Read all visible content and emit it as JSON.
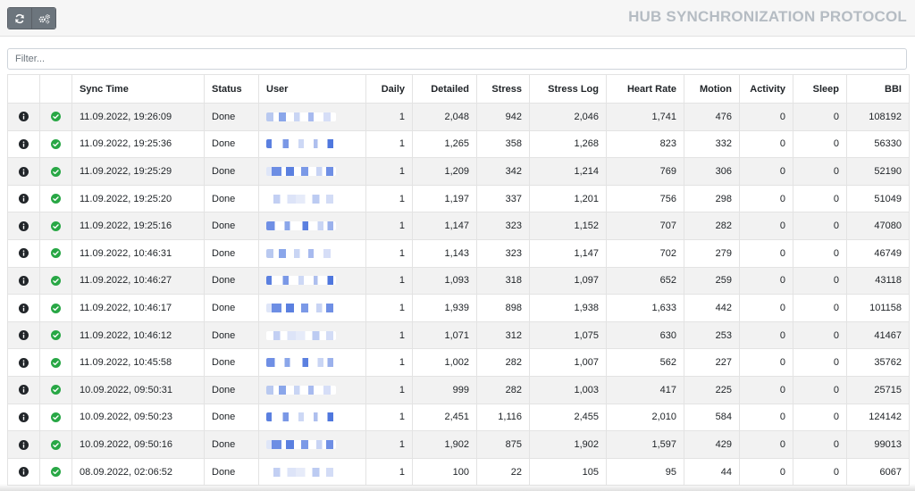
{
  "header": {
    "title": "HUB SYNCHRONIZATION PROTOCOL",
    "buttons": [
      {
        "icon": "refresh-icon"
      },
      {
        "icon": "gears-icon"
      }
    ]
  },
  "filter": {
    "placeholder": "Filter...",
    "value": ""
  },
  "colors": {
    "success": "#28a745",
    "info": "#212529",
    "button": "#6c757d",
    "title": "#b5bcc3",
    "stripe": "#f2f2f2"
  },
  "table": {
    "columns": [
      "",
      "",
      "Sync Time",
      "Status",
      "User",
      "Daily",
      "Detailed",
      "Stress",
      "Stress Log",
      "Heart Rate",
      "Motion",
      "Activity",
      "Sleep",
      "BBI"
    ],
    "rows": [
      {
        "sync_time": "11.09.2022, 19:26:09",
        "status": "Done",
        "daily": "1",
        "detailed": "2,048",
        "stress": "942",
        "stress_log": "2,046",
        "heart_rate": "1,741",
        "motion": "476",
        "activity": "0",
        "sleep": "0",
        "bbi": "108192"
      },
      {
        "sync_time": "11.09.2022, 19:25:36",
        "status": "Done",
        "daily": "1",
        "detailed": "1,265",
        "stress": "358",
        "stress_log": "1,268",
        "heart_rate": "823",
        "motion": "332",
        "activity": "0",
        "sleep": "0",
        "bbi": "56330"
      },
      {
        "sync_time": "11.09.2022, 19:25:29",
        "status": "Done",
        "daily": "1",
        "detailed": "1,209",
        "stress": "342",
        "stress_log": "1,214",
        "heart_rate": "769",
        "motion": "306",
        "activity": "0",
        "sleep": "0",
        "bbi": "52190"
      },
      {
        "sync_time": "11.09.2022, 19:25:20",
        "status": "Done",
        "daily": "1",
        "detailed": "1,197",
        "stress": "337",
        "stress_log": "1,201",
        "heart_rate": "756",
        "motion": "298",
        "activity": "0",
        "sleep": "0",
        "bbi": "51049"
      },
      {
        "sync_time": "11.09.2022, 19:25:16",
        "status": "Done",
        "daily": "1",
        "detailed": "1,147",
        "stress": "323",
        "stress_log": "1,152",
        "heart_rate": "707",
        "motion": "282",
        "activity": "0",
        "sleep": "0",
        "bbi": "47080"
      },
      {
        "sync_time": "11.09.2022, 10:46:31",
        "status": "Done",
        "daily": "1",
        "detailed": "1,143",
        "stress": "323",
        "stress_log": "1,147",
        "heart_rate": "702",
        "motion": "279",
        "activity": "0",
        "sleep": "0",
        "bbi": "46749"
      },
      {
        "sync_time": "11.09.2022, 10:46:27",
        "status": "Done",
        "daily": "1",
        "detailed": "1,093",
        "stress": "318",
        "stress_log": "1,097",
        "heart_rate": "652",
        "motion": "259",
        "activity": "0",
        "sleep": "0",
        "bbi": "43118"
      },
      {
        "sync_time": "11.09.2022, 10:46:17",
        "status": "Done",
        "daily": "1",
        "detailed": "1,939",
        "stress": "898",
        "stress_log": "1,938",
        "heart_rate": "1,633",
        "motion": "442",
        "activity": "0",
        "sleep": "0",
        "bbi": "101158"
      },
      {
        "sync_time": "11.09.2022, 10:46:12",
        "status": "Done",
        "daily": "1",
        "detailed": "1,071",
        "stress": "312",
        "stress_log": "1,075",
        "heart_rate": "630",
        "motion": "253",
        "activity": "0",
        "sleep": "0",
        "bbi": "41467"
      },
      {
        "sync_time": "11.09.2022, 10:45:58",
        "status": "Done",
        "daily": "1",
        "detailed": "1,002",
        "stress": "282",
        "stress_log": "1,007",
        "heart_rate": "562",
        "motion": "227",
        "activity": "0",
        "sleep": "0",
        "bbi": "35762"
      },
      {
        "sync_time": "10.09.2022, 09:50:31",
        "status": "Done",
        "daily": "1",
        "detailed": "999",
        "stress": "282",
        "stress_log": "1,003",
        "heart_rate": "417",
        "motion": "225",
        "activity": "0",
        "sleep": "0",
        "bbi": "25715"
      },
      {
        "sync_time": "10.09.2022, 09:50:23",
        "status": "Done",
        "daily": "1",
        "detailed": "2,451",
        "stress": "1,116",
        "stress_log": "2,455",
        "heart_rate": "2,010",
        "motion": "584",
        "activity": "0",
        "sleep": "0",
        "bbi": "124142"
      },
      {
        "sync_time": "10.09.2022, 09:50:16",
        "status": "Done",
        "daily": "1",
        "detailed": "1,902",
        "stress": "875",
        "stress_log": "1,902",
        "heart_rate": "1,597",
        "motion": "429",
        "activity": "0",
        "sleep": "0",
        "bbi": "99013"
      },
      {
        "sync_time": "08.09.2022, 02:06:52",
        "status": "Done",
        "daily": "1",
        "detailed": "100",
        "stress": "22",
        "stress_log": "105",
        "heart_rate": "95",
        "motion": "44",
        "activity": "0",
        "sleep": "0",
        "bbi": "6067"
      }
    ]
  }
}
